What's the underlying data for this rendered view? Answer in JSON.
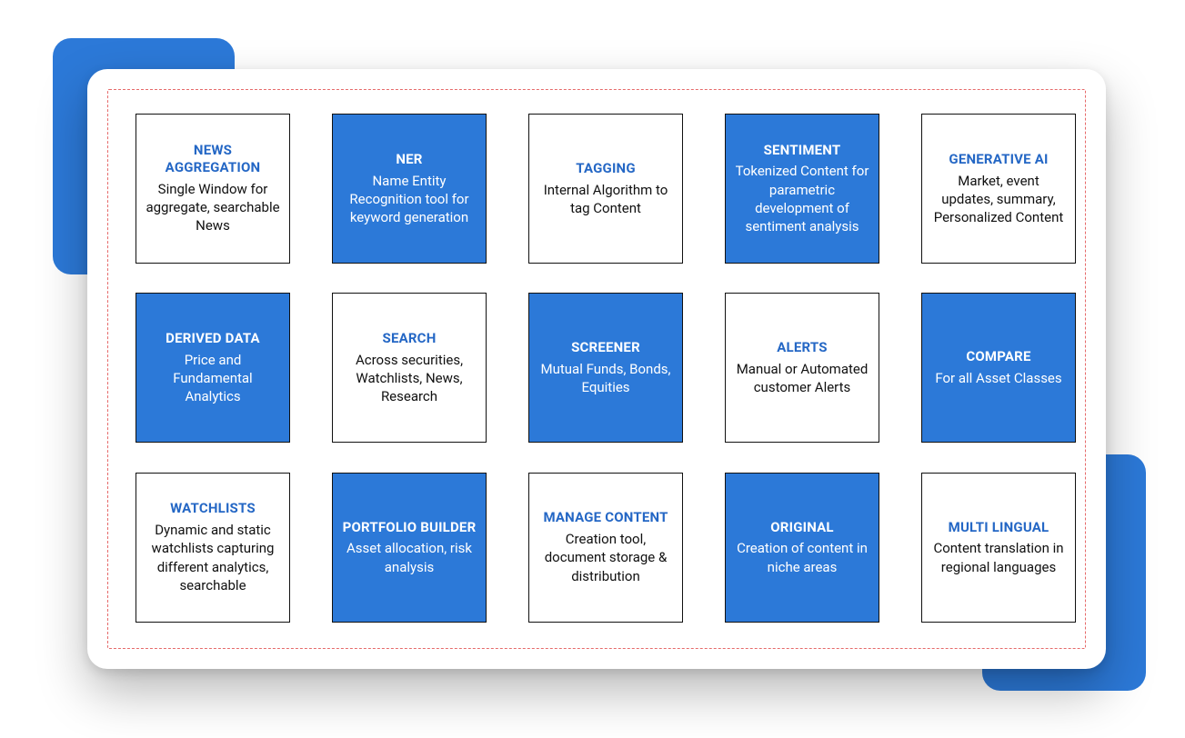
{
  "colors": {
    "accent": "#2c79d8",
    "dashed_border": "#e66a6a",
    "text": "#111111"
  },
  "tiles": [
    {
      "title": "NEWS AGGREGATION",
      "desc": "Single Window for aggregate, searchable News",
      "variant": "light"
    },
    {
      "title": "NER",
      "desc": "Name Entity Recognition tool for keyword generation",
      "variant": "dark"
    },
    {
      "title": "TAGGING",
      "desc": "Internal Algorithm to tag Content",
      "variant": "light"
    },
    {
      "title": "SENTIMENT",
      "desc": "Tokenized Content for parametric development of sentiment analysis",
      "variant": "dark"
    },
    {
      "title": "GENERATIVE AI",
      "desc": "Market, event updates, summary, Personalized Content",
      "variant": "light"
    },
    {
      "title": "DERIVED DATA",
      "desc": "Price and Fundamental Analytics",
      "variant": "dark"
    },
    {
      "title": "SEARCH",
      "desc": "Across securities, Watchlists, News, Research",
      "variant": "light"
    },
    {
      "title": "SCREENER",
      "desc": "Mutual Funds, Bonds, Equities",
      "variant": "dark"
    },
    {
      "title": "ALERTS",
      "desc": "Manual or Automated customer Alerts",
      "variant": "light"
    },
    {
      "title": "COMPARE",
      "desc": "For all Asset Classes",
      "variant": "dark"
    },
    {
      "title": "WATCHLISTS",
      "desc": "Dynamic and static watchlists capturing different analytics, searchable",
      "variant": "light"
    },
    {
      "title": "PORTFOLIO BUILDER",
      "desc": "Asset allocation, risk analysis",
      "variant": "dark"
    },
    {
      "title": "MANAGE CONTENT",
      "desc": "Creation tool, document storage & distribution",
      "variant": "light"
    },
    {
      "title": "ORIGINAL",
      "desc": "Creation of content in niche areas",
      "variant": "dark"
    },
    {
      "title": "MULTI LINGUAL",
      "desc": "Content translation in regional languages",
      "variant": "light"
    }
  ]
}
